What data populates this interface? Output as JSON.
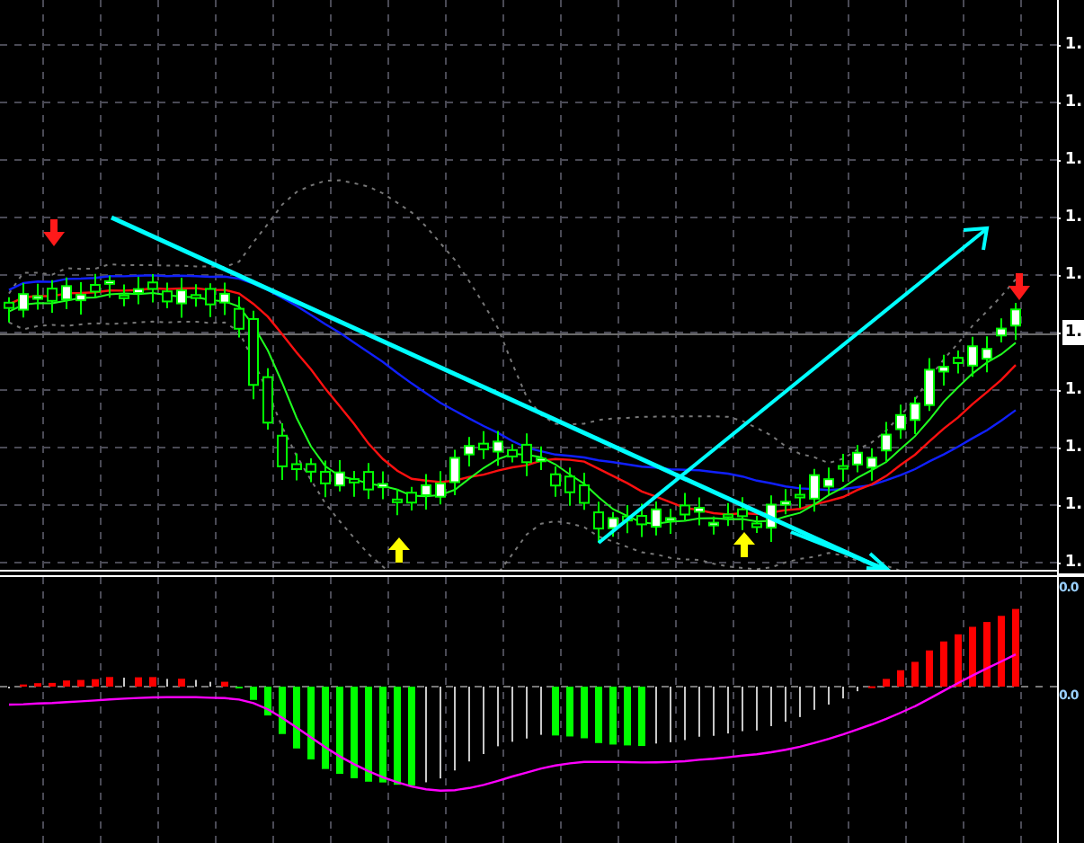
{
  "price_axis": {
    "labels": [
      {
        "text": "1.",
        "kind": "tick"
      },
      {
        "text": "1.",
        "kind": "tick"
      },
      {
        "text": "1.",
        "kind": "tick"
      },
      {
        "text": "1.",
        "kind": "tick"
      },
      {
        "text": "1.",
        "kind": "tick"
      },
      {
        "text": "1.",
        "kind": "current"
      },
      {
        "text": "1.",
        "kind": "tick"
      },
      {
        "text": "1.",
        "kind": "tick"
      },
      {
        "text": "1.",
        "kind": "tick"
      },
      {
        "text": "1.",
        "kind": "tick"
      }
    ]
  },
  "indicator_axis": {
    "labels": [
      "0.0",
      "0.0"
    ]
  }
}
